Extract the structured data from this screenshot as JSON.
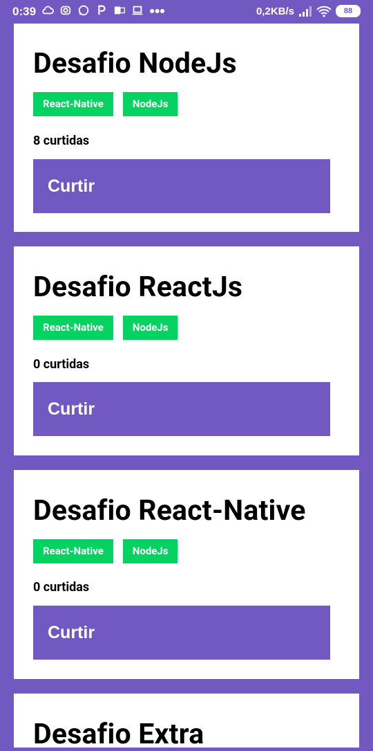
{
  "status_bar": {
    "time": "0:39",
    "network_speed": "0,2KB/s",
    "battery": "88",
    "icons": [
      "cloud-icon",
      "instagram-icon",
      "whatsapp-icon",
      "paypal-icon",
      "outlook-icon",
      "laptop-icon",
      "more-dots-icon",
      "signal-icon",
      "wifi-icon",
      "battery-icon"
    ]
  },
  "colors": {
    "background": "#7159c1",
    "tag": "#04d361",
    "button": "#7159c1",
    "card": "#ffffff"
  },
  "repositories": [
    {
      "title": "Desafio NodeJs",
      "techs": [
        "React-Native",
        "NodeJs"
      ],
      "likes_text": "8 curtidas",
      "button_label": "Curtir"
    },
    {
      "title": "Desafio ReactJs",
      "techs": [
        "React-Native",
        "NodeJs"
      ],
      "likes_text": "0 curtidas",
      "button_label": "Curtir"
    },
    {
      "title": "Desafio React-Native",
      "techs": [
        "React-Native",
        "NodeJs"
      ],
      "likes_text": "0 curtidas",
      "button_label": "Curtir"
    },
    {
      "title": "Desafio Extra"
    }
  ]
}
